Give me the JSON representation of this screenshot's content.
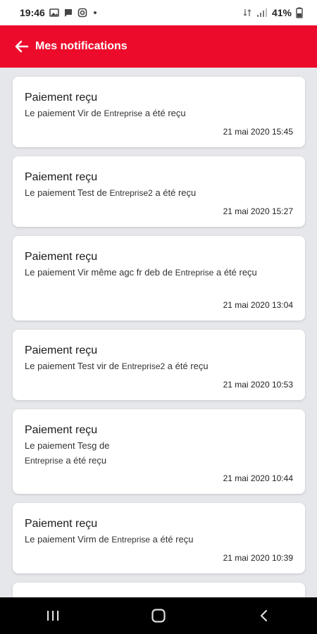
{
  "status_bar": {
    "time": "19:46",
    "battery": "41%"
  },
  "header": {
    "title": "Mes notifications"
  },
  "notifications": [
    {
      "title": "Paiement reçu",
      "msg_prefix": "Le  paiement Vir de ",
      "company": "Entreprise",
      "msg_suffix": " a été reçu",
      "date": "21 mai 2020 15:45"
    },
    {
      "title": "Paiement reçu",
      "msg_prefix": "Le  paiement Test  de ",
      "company": "Entreprise2",
      "msg_suffix": " a été reçu",
      "date": "21 mai 2020 15:27"
    },
    {
      "title": "Paiement reçu",
      "msg_prefix": "Le  paiement Vir même agc fr deb de ",
      "company": "Entreprise",
      "msg_suffix": " a été reçu",
      "date": "21 mai 2020 13:04"
    },
    {
      "title": "Paiement reçu",
      "msg_prefix": "Le  paiement Test vir de ",
      "company": "Entreprise2",
      "msg_suffix": " a été reçu",
      "date": "21 mai 2020 10:53"
    },
    {
      "title": "Paiement reçu",
      "msg_prefix": "Le  paiement Tesg de ",
      "company": "Entreprise",
      "msg_suffix": " a été reçu",
      "date": "21 mai 2020 10:44"
    },
    {
      "title": "Paiement reçu",
      "msg_prefix": "Le  paiement Virm  de ",
      "company": "Entreprise",
      "msg_suffix": " a été reçu",
      "date": "21 mai 2020 10:39"
    }
  ],
  "colors": {
    "accent": "#ec0b2b",
    "background": "#e6e7eb",
    "card": "#ffffff"
  }
}
